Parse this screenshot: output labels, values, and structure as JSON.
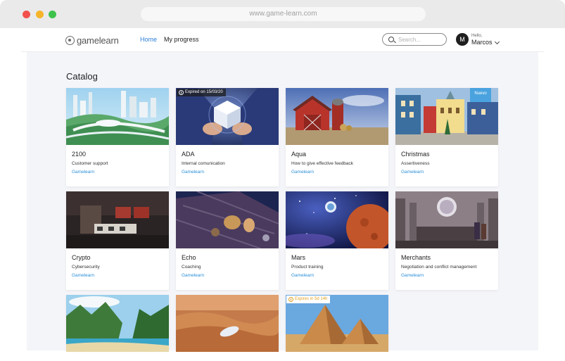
{
  "browser": {
    "url": "www.game-learn.com"
  },
  "nav": {
    "brand": "gamelearn",
    "links": [
      {
        "label": "Home",
        "active": true
      },
      {
        "label": "My progress",
        "active": false
      }
    ],
    "search_placeholder": "Search...",
    "user": {
      "initial": "M",
      "greeting": "Hello,",
      "name": "Marcos"
    }
  },
  "catalog": {
    "title": "Catalog",
    "cards": [
      {
        "title": "2100",
        "subtitle": "Customer support",
        "brand": "Gamelearn"
      },
      {
        "title": "ADA",
        "subtitle": "Internal comunication",
        "brand": "Gamelearn",
        "badge": "Expired on 15/03/20"
      },
      {
        "title": "Aqua",
        "subtitle": "How to give effective feedback",
        "brand": "Gamelearn"
      },
      {
        "title": "Christmas",
        "subtitle": "Assertiveness",
        "brand": "Gamelearn",
        "badge": "Nuevo"
      },
      {
        "title": "Crypto",
        "subtitle": "Cybersecurity",
        "brand": "Gamelearn"
      },
      {
        "title": "Echo",
        "subtitle": "Coaching",
        "brand": "Gamelearn"
      },
      {
        "title": "Mars",
        "subtitle": "Product training",
        "brand": "Gamelearn"
      },
      {
        "title": "Merchants",
        "subtitle": "Negotiation and conflict management",
        "brand": "Gamelearn"
      },
      {
        "badge": "Expires in 5d 14h"
      }
    ]
  },
  "colors": {
    "accent": "#2b7fd8",
    "brand_link": "#2b8fd8",
    "badge_new": "#4aa3df",
    "badge_expires": "#e0a020",
    "background": "#f4f5f9"
  }
}
